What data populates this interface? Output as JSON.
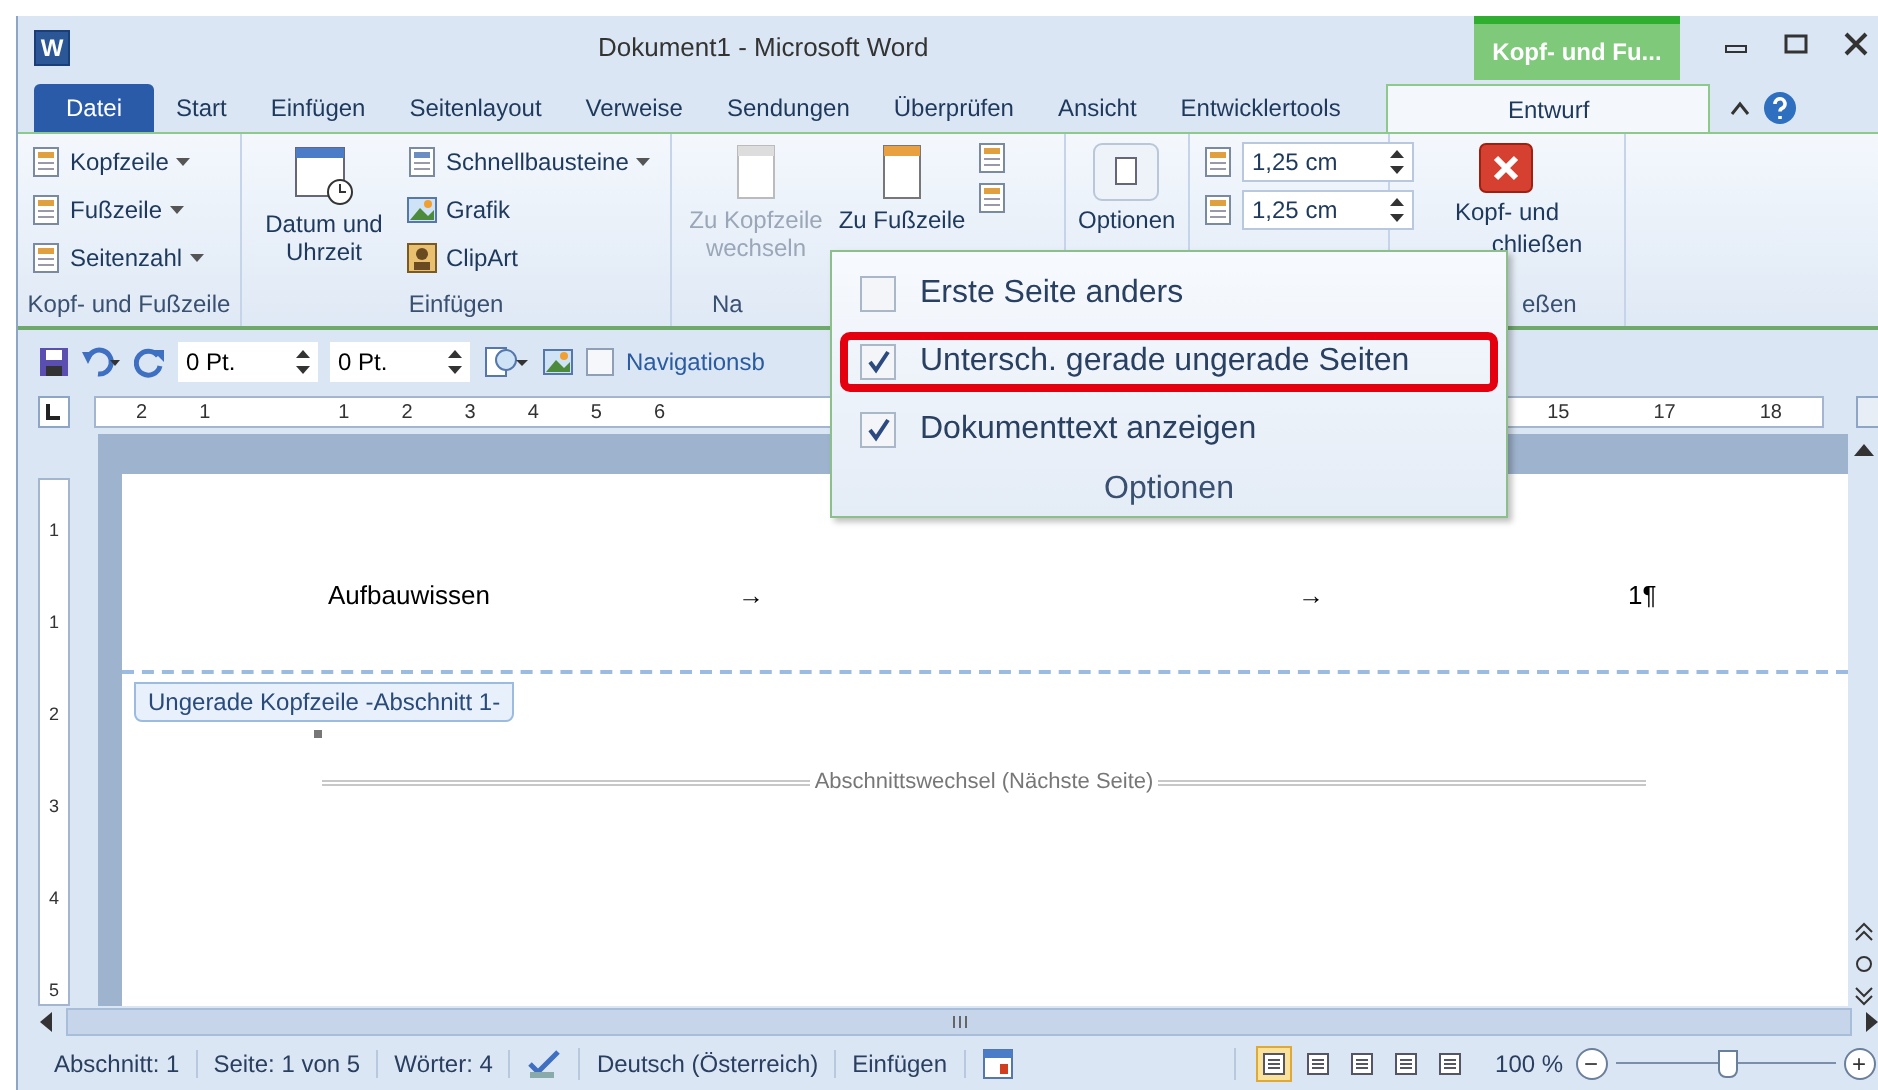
{
  "window": {
    "app_icon": "W",
    "title": "Dokument1  -  Microsoft Word",
    "contextual_tab": "Kopf- und Fu..."
  },
  "tabs": [
    {
      "label": "Datei",
      "kind": "file",
      "selected": false
    },
    {
      "label": "Start",
      "kind": "tab",
      "selected": false
    },
    {
      "label": "Einfügen",
      "kind": "tab",
      "selected": false
    },
    {
      "label": "Seitenlayout",
      "kind": "tab",
      "selected": false
    },
    {
      "label": "Verweise",
      "kind": "tab",
      "selected": false
    },
    {
      "label": "Sendungen",
      "kind": "tab",
      "selected": false
    },
    {
      "label": "Überprüfen",
      "kind": "tab",
      "selected": false
    },
    {
      "label": "Ansicht",
      "kind": "tab",
      "selected": false
    },
    {
      "label": "Entwicklertools",
      "kind": "tab",
      "selected": false
    },
    {
      "label": "Entwurf",
      "kind": "contextual",
      "selected": true
    }
  ],
  "ribbon": {
    "header_footer": {
      "title": "Kopf- und Fußzeile",
      "items": [
        {
          "label": "Kopfzeile"
        },
        {
          "label": "Fußzeile"
        },
        {
          "label": "Seitenzahl"
        }
      ]
    },
    "insert": {
      "title": "Einfügen",
      "big_button": "Datum und Uhrzeit",
      "items": [
        {
          "label": "Schnellbausteine",
          "dropdown": true
        },
        {
          "label": "Grafik",
          "dropdown": false
        },
        {
          "label": "ClipArt",
          "dropdown": false
        }
      ]
    },
    "navigation": {
      "title": "Na",
      "buttons": [
        {
          "label": "Zu Kopfzeile wechseln",
          "disabled": true
        },
        {
          "label": "Zu Fußzeile",
          "disabled": false
        }
      ]
    },
    "options": {
      "button": "Optionen"
    },
    "position": {
      "fields": [
        "1,25 cm",
        "1,25 cm"
      ]
    },
    "close": {
      "lines": [
        "Kopf- und",
        "chließen"
      ],
      "title": "eßen"
    }
  },
  "quick_access": {
    "fields": [
      "0 Pt.",
      "0 Pt."
    ],
    "checkbox": {
      "label": "Navigationsb",
      "checked": false
    }
  },
  "options_popup": {
    "title": "Optionen",
    "items": [
      {
        "label": "Erste Seite anders",
        "checked": false,
        "highlighted": false
      },
      {
        "label": "Untersch. gerade  ungerade Seiten",
        "checked": true,
        "highlighted": true
      },
      {
        "label": "Dokumenttext anzeigen",
        "checked": true,
        "highlighted": false
      }
    ]
  },
  "ruler": {
    "left_labels": [
      "2",
      "1",
      "1",
      "2",
      "3",
      "4",
      "5",
      "6"
    ],
    "right_labels": [
      "15",
      "17",
      "18"
    ]
  },
  "vertical_ruler": {
    "labels": [
      "1",
      "1",
      "2",
      "3",
      "4",
      "5"
    ]
  },
  "document": {
    "header_parts": [
      "Aufbauwissen",
      "→",
      "→",
      "1¶"
    ],
    "header_tag": "Ungerade Kopfzeile -Abschnitt 1-",
    "section_break": "Abschnittswechsel (Nächste Seite)"
  },
  "status_bar": {
    "items": [
      "Abschnitt: 1",
      "Seite: 1 von 5",
      "Wörter: 4"
    ],
    "language": "Deutsch (Österreich)",
    "mode": "Einfügen",
    "views": [
      {
        "selected": true
      },
      {
        "selected": false
      },
      {
        "selected": false
      },
      {
        "selected": false
      },
      {
        "selected": false
      }
    ],
    "zoom": "100 %",
    "zoom_level": {
      "level": 0.5
    },
    "zoom_out": "−",
    "zoom_in": "+"
  }
}
